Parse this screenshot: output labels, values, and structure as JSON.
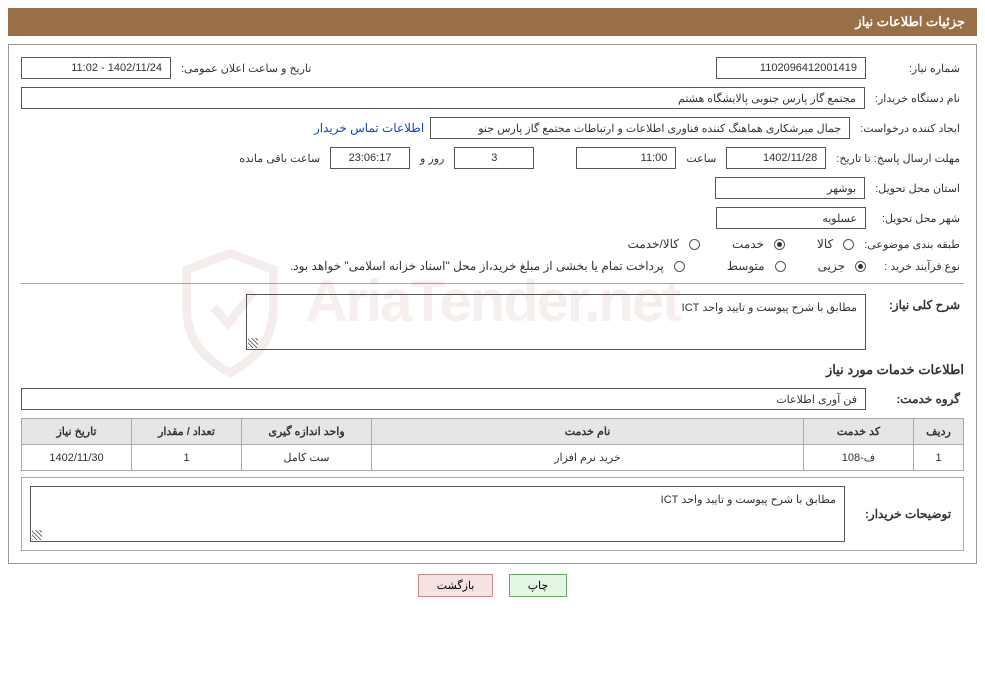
{
  "header": {
    "title": "جزئیات اطلاعات نیاز"
  },
  "fields": {
    "need_no_label": "شماره نیاز:",
    "need_no": "1102096412001419",
    "announce_dt_label": "تاریخ و ساعت اعلان عمومی:",
    "announce_dt": "1402/11/24 - 11:02",
    "buyer_label": "نام دستگاه خریدار:",
    "buyer": "مجتمع گاز پارس جنوبی  پالایشگاه هشتم",
    "requester_label": "ایجاد کننده درخواست:",
    "requester": "جمال میرشکاری هماهنگ کننده فناوری اطلاعات و ارتباطات مجتمع گاز پارس جنو",
    "contact_link": "اطلاعات تماس خریدار",
    "deadline_label": "مهلت ارسال پاسخ: تا تاریخ:",
    "deadline_date": "1402/11/28",
    "time_label": "ساعت",
    "deadline_time": "11:00",
    "days_remaining": "3",
    "days_and_text": "روز و",
    "time_remaining": "23:06:17",
    "time_remaining_suffix": "ساعت باقی مانده",
    "province_label": "استان محل تحویل:",
    "province": "بوشهر",
    "city_label": "شهر محل تحویل:",
    "city": "عسلویه",
    "category_label": "طبقه بندی موضوعی:",
    "cat_goods": "کالا",
    "cat_service": "خدمت",
    "cat_goods_service": "کالا/خدمت",
    "purchase_type_label": "نوع فرآیند خرید :",
    "pt_partial": "جزیی",
    "pt_medium": "متوسط",
    "payment_note": "پرداخت تمام یا بخشی از مبلغ خرید،از محل \"اسناد خزانه اسلامی\" خواهد بود.",
    "overall_desc_label": "شرح کلی نیاز:",
    "overall_desc": "مطابق با شرح پیوست و تایید واحد ICT",
    "services_info_title": "اطلاعات خدمات مورد نیاز",
    "service_group_label": "گروه خدمت:",
    "service_group": "فن آوری اطلاعات",
    "buyer_desc_label": "توضیحات خریدار:",
    "buyer_desc": "مطابق با شرح پیوست و تایید واحد ICT"
  },
  "table": {
    "headers": {
      "row": "ردیف",
      "code": "کد خدمت",
      "name": "نام خدمت",
      "unit": "واحد اندازه گیری",
      "qty": "تعداد / مقدار",
      "date": "تاریخ نیاز"
    },
    "rows": [
      {
        "row": "1",
        "code": "ف-108",
        "name": "خرید نرم افزار",
        "unit": "ست کامل",
        "qty": "1",
        "date": "1402/11/30"
      }
    ]
  },
  "buttons": {
    "print": "چاپ",
    "back": "بازگشت"
  },
  "watermark": "AriaTender.net"
}
